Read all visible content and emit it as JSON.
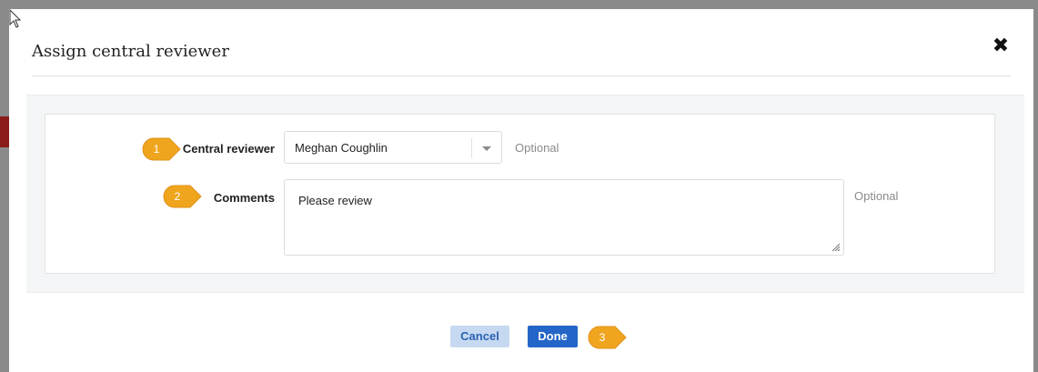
{
  "dialog": {
    "title": "Assign central reviewer",
    "close_icon": "close-icon"
  },
  "form": {
    "central_reviewer": {
      "label": "Central reviewer",
      "value": "Meghan Coughlin",
      "hint": "Optional"
    },
    "comments": {
      "label": "Comments",
      "value": "Please review",
      "hint": "Optional"
    }
  },
  "footer": {
    "cancel_label": "Cancel",
    "done_label": "Done"
  },
  "callouts": [
    "1",
    "2",
    "3"
  ],
  "colors": {
    "accent": "#2466c7",
    "cancel_bg": "#c7d9f0",
    "callout": "#f0a51e"
  }
}
